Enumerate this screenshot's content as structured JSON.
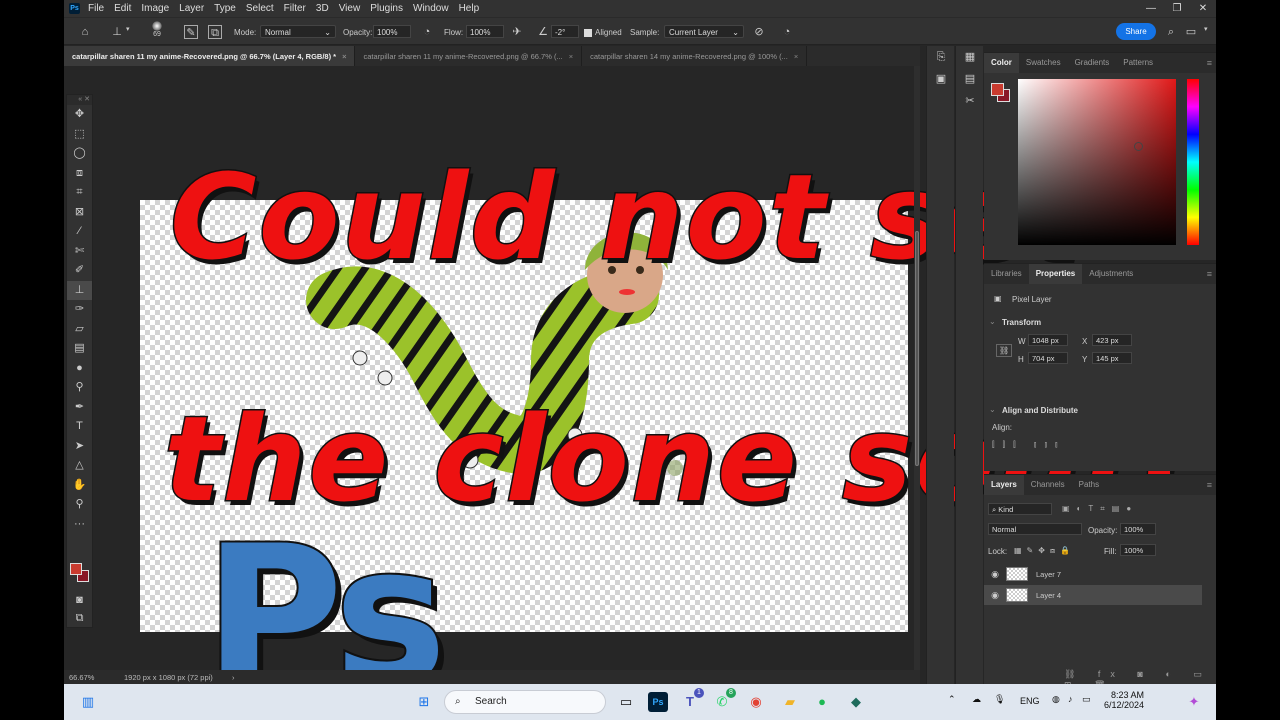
{
  "menubar": {
    "logo": "Ps",
    "items": [
      "File",
      "Edit",
      "Image",
      "Layer",
      "Type",
      "Select",
      "Filter",
      "3D",
      "View",
      "Plugins",
      "Window",
      "Help"
    ]
  },
  "options": {
    "brush_size": "69",
    "mode_label": "Mode:",
    "mode_value": "Normal",
    "opacity_label": "Opacity:",
    "opacity_value": "100%",
    "flow_label": "Flow:",
    "flow_value": "100%",
    "angle_value": "-2°",
    "aligned_label": "Aligned",
    "sample_label": "Sample:",
    "sample_value": "Current Layer",
    "share_label": "Share"
  },
  "tabs": [
    "catarpillar sharen 11 my anime-Recovered.png @ 66.7% (Layer 4, RGB/8) *",
    "catarpillar sharen 11 my anime-Recovered.png @ 66.7% (...",
    "catarpillar sharen 14 my anime-Recovered.png @ 100% (..."
  ],
  "overlay": {
    "line1": "Could not set",
    "line2": "the clone source",
    "logo_letters": "Ps"
  },
  "status": {
    "zoom": "66.67%",
    "doc_size": "1920 px x 1080 px (72 ppi)"
  },
  "color_panel": {
    "tabs": [
      "Color",
      "Swatches",
      "Gradients",
      "Patterns"
    ],
    "fg_color": "#c93b2f",
    "bg_color": "#8a1726"
  },
  "properties": {
    "tabs": [
      "Libraries",
      "Properties",
      "Adjustments"
    ],
    "layer_type": "Pixel Layer",
    "section_transform": "Transform",
    "w_label": "W",
    "w_value": "1048 px",
    "h_label": "H",
    "h_value": "704 px",
    "x_label": "X",
    "x_value": "423 px",
    "y_label": "Y",
    "y_value": "145 px",
    "section_align": "Align and Distribute",
    "align_label": "Align:"
  },
  "layers": {
    "tabs": [
      "Layers",
      "Channels",
      "Paths"
    ],
    "filter_kind": "Kind",
    "blend_mode": "Normal",
    "opacity_label": "Opacity:",
    "opacity_value": "100%",
    "lock_label": "Lock:",
    "fill_label": "Fill:",
    "fill_value": "100%",
    "rows": [
      "Layer 7",
      "Layer 4"
    ]
  },
  "taskbar": {
    "search_placeholder": "Search",
    "lang": "ENG",
    "time": "8:23 AM",
    "date": "6/12/2024",
    "teams_badge": "1",
    "whatsapp_badge": "8"
  }
}
